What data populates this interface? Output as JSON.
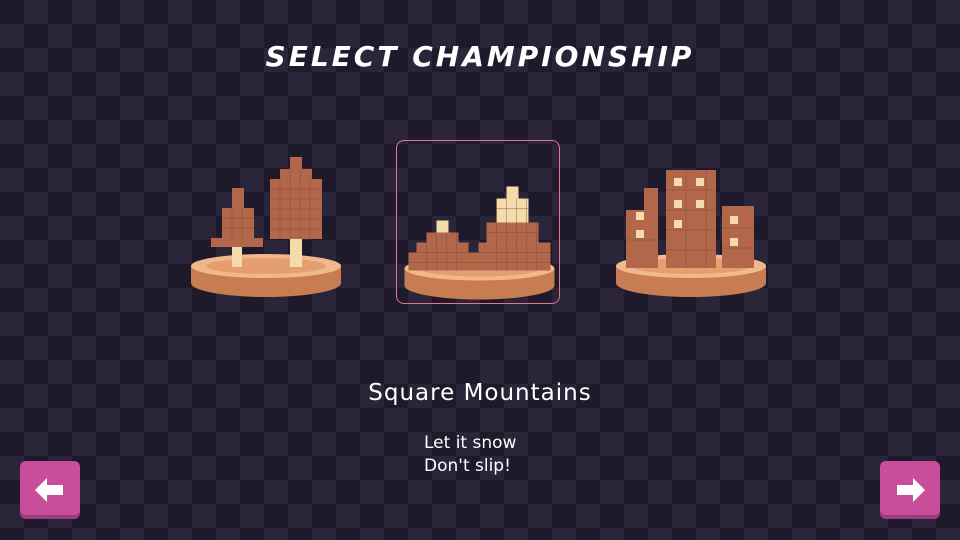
{
  "screen": {
    "title": "SELECT CHAMPIONSHIP"
  },
  "championships": [
    {
      "id": "forest",
      "icon": "pixel-trees-island-icon",
      "selected": false
    },
    {
      "id": "mountains",
      "icon": "pixel-mountains-island-icon",
      "selected": true
    },
    {
      "id": "city",
      "icon": "pixel-city-island-icon",
      "selected": false
    }
  ],
  "selected": {
    "name": "Square Mountains",
    "description_lines": [
      "Let it snow",
      "Don't slip!"
    ]
  },
  "nav": {
    "prev_icon": "arrow-left-icon",
    "next_icon": "arrow-right-icon"
  },
  "colors": {
    "background": "#1e1a2c",
    "selection_border": "#e5768e",
    "button": "#c84e9c",
    "model_brown": "#b3674a",
    "snow": "#f4dcaa"
  }
}
